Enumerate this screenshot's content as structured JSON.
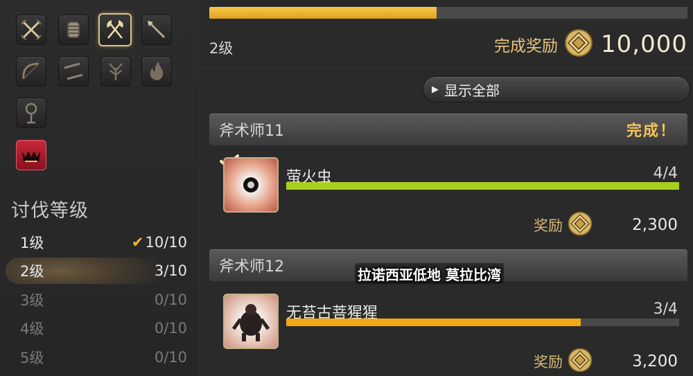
{
  "left_panel": {
    "job_icons": [
      {
        "name": "sword-icon"
      },
      {
        "name": "gauntlet-icon"
      },
      {
        "name": "axe-icon",
        "selected": true
      },
      {
        "name": "lance-icon"
      },
      {
        "name": "bow-icon"
      },
      {
        "name": "daggers-icon"
      },
      {
        "name": "thorn-icon"
      },
      {
        "name": "flame-icon"
      },
      {
        "name": "staff-icon"
      },
      {
        "name": "grand-company-icon"
      }
    ],
    "section_title": "讨伐等级",
    "ranks": [
      {
        "label": "1级",
        "value": "10/10",
        "check": "✔",
        "state": "done"
      },
      {
        "label": "2级",
        "value": "3/10",
        "check": "",
        "state": "active"
      },
      {
        "label": "3级",
        "value": "0/10",
        "check": "",
        "state": "dim"
      },
      {
        "label": "4级",
        "value": "0/10",
        "check": "",
        "state": "dim"
      },
      {
        "label": "5级",
        "value": "0/10",
        "check": "",
        "state": "dim"
      }
    ]
  },
  "rank_summary": {
    "progress": 0.475,
    "rank_label": "2级",
    "completion_reward_label": "完成奖励",
    "completion_reward_value": "10,000"
  },
  "show_all_button": {
    "icon": "▶",
    "label": "显示全部"
  },
  "entries": [
    {
      "header": "斧术师11",
      "status": "完成！",
      "mob_name": "萤火虫",
      "count": "4/4",
      "progress": 1.0,
      "bar_color": "#a8d020",
      "reward_label": "奖励",
      "reward_value": "2,300",
      "completed": true
    },
    {
      "header": "斧术师12",
      "status": "",
      "mob_name": "无苔古菩猩猩",
      "count": "3/4",
      "progress": 0.75,
      "bar_color": "#f0a818",
      "reward_label": "奖励",
      "reward_value": "3,200",
      "completed": false
    }
  ],
  "location_caption": "拉诺西亚低地 莫拉比湾",
  "colors": {
    "gold_text": "#e8c47a",
    "done_orange": "#f4c45a",
    "check": "#f2b632"
  }
}
